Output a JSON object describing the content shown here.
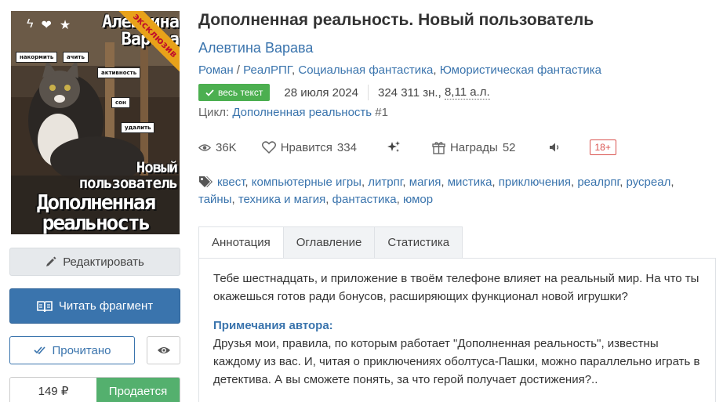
{
  "cover": {
    "badge": "эксклюзив",
    "author_line1": "Алевтина",
    "author_line2": "Варава",
    "chips": [
      "накормить",
      "ачить",
      "активность",
      "сон",
      "удалить"
    ],
    "title_small_1": "Новый",
    "title_small_2": "пользователь",
    "title_big_1": "Дополненная",
    "title_big_2": "реальность"
  },
  "actions": {
    "edit_label": "Редактировать",
    "read_label": "Читать фрагмент",
    "done_label": "Прочитано",
    "price": "149 ₽",
    "buy_label": "Продается"
  },
  "book": {
    "title": "Дополненная реальность. Новый пользователь",
    "author": "Алевтина Варава",
    "genres": [
      "Роман",
      "РеалРПГ",
      "Социальная фантастика",
      "Юмористическая фантастика"
    ],
    "full_text_label": "весь текст",
    "date": "28 июля 2024",
    "size_chars": "324 311 зн.,",
    "size_al": "8,11 а.л.",
    "cycle_label": "Цикл:",
    "cycle_name": "Дополненная реальность",
    "cycle_number": "#1"
  },
  "stats": {
    "views": "36K",
    "likes_label": "Нравится",
    "likes": "334",
    "awards_label": "Награды",
    "awards": "52",
    "age": "18+"
  },
  "tags": [
    "квест",
    "компьютерные игры",
    "литрпг",
    "магия",
    "мистика",
    "приключения",
    "реалрпг",
    "русреал",
    "тайны",
    "техника и магия",
    "фантастика",
    "юмор"
  ],
  "tabs": [
    "Аннотация",
    "Оглавление",
    "Статистика"
  ],
  "annotation": {
    "text": "Тебе шестнадцать, и приложение в твоём телефоне влияет на реальный мир. На что ты окажешься готов ради бонусов, расширяющих функционал новой игрушки?",
    "note_heading": "Примечания автора:",
    "note_text": "Друзья мои, правила, по которым работает \"Дополненная реальность\", известны каждому из вас. И, читая о приключениях оболтуса-Пашки, можно параллельно играть в детектива. А вы сможете понять, за что герой получает достижения?.."
  },
  "colors": {
    "link": "#3a74ad",
    "primary_button": "#3a74ad",
    "buy_button": "#54b06e",
    "full_text_badge": "#4caf50",
    "age_badge": "#d9534f",
    "cover_badge": "#e8a21a"
  }
}
